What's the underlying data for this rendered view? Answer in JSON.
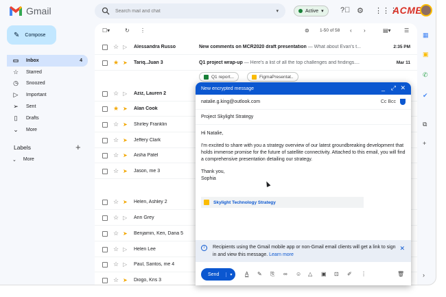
{
  "app": {
    "title": "Gmail",
    "org": "ACME"
  },
  "search": {
    "placeholder": "Search mail and chat"
  },
  "status": {
    "label": "Active"
  },
  "compose_label": "Compose",
  "nav": [
    {
      "label": "Inbox",
      "count": "4",
      "icon": "inbox-icon"
    },
    {
      "label": "Starred",
      "count": "",
      "icon": "star-icon"
    },
    {
      "label": "Snoozed",
      "count": "",
      "icon": "clock-icon"
    },
    {
      "label": "Important",
      "count": "",
      "icon": "important-icon"
    },
    {
      "label": "Sent",
      "count": "",
      "icon": "send-icon"
    },
    {
      "label": "Drafts",
      "count": "",
      "icon": "draft-icon"
    },
    {
      "label": "More",
      "count": "",
      "icon": "chevron-down-icon"
    }
  ],
  "labels": {
    "title": "Labels",
    "more": "More"
  },
  "toolbar": {
    "pagination": "1-50 of 58"
  },
  "emails": [
    {
      "sender": "Alessandra Russo",
      "subject": "New comments on MCR2020 draft presentation",
      "snippet": " — What about Evan's t...",
      "date": "2:35 PM",
      "unread": true,
      "starred": false,
      "important": false
    },
    {
      "sender": "Tariq..Juan 3",
      "subject": "Q1 project wrap-up",
      "snippet": " — Here's a list of all the top challenges and findings....",
      "date": "Mar 11",
      "unread": true,
      "starred": true,
      "important": true
    },
    {
      "sender": "Aziz, Lauren 2",
      "subject": "",
      "snippet": "",
      "date": "",
      "unread": true,
      "starred": false,
      "important": false
    },
    {
      "sender": "Alan Cook",
      "subject": "",
      "snippet": "",
      "date": "",
      "unread": true,
      "starred": true,
      "important": true
    },
    {
      "sender": "Shirley Franklin",
      "subject": "",
      "snippet": "",
      "date": "",
      "unread": false,
      "starred": false,
      "important": true
    },
    {
      "sender": "Jeffery Clark",
      "subject": "",
      "snippet": "",
      "date": "",
      "unread": false,
      "starred": false,
      "important": true
    },
    {
      "sender": "Aisha Patel",
      "subject": "",
      "snippet": "",
      "date": "",
      "unread": false,
      "starred": false,
      "important": true
    },
    {
      "sender": "Jason, me 3",
      "subject": "",
      "snippet": "",
      "date": "",
      "unread": false,
      "starred": false,
      "important": true
    },
    {
      "sender": "Helen, Ashley 2",
      "subject": "",
      "snippet": "",
      "date": "",
      "unread": false,
      "starred": false,
      "important": true
    },
    {
      "sender": "Ann Grey",
      "subject": "",
      "snippet": "",
      "date": "",
      "unread": false,
      "starred": false,
      "important": false
    },
    {
      "sender": "Benjamin, Ken, Dana 5",
      "subject": "",
      "snippet": "",
      "date": "",
      "unread": false,
      "starred": false,
      "important": true
    },
    {
      "sender": "Helen Lee",
      "subject": "",
      "snippet": "",
      "date": "",
      "unread": false,
      "starred": false,
      "important": false
    },
    {
      "sender": "Paul, Santos, me 4",
      "subject": "",
      "snippet": "",
      "date": "",
      "unread": false,
      "starred": false,
      "important": false
    },
    {
      "sender": "Diogo, Kris 3",
      "subject": "",
      "snippet": "",
      "date": "",
      "unread": false,
      "starred": false,
      "important": true
    }
  ],
  "attachments_chips": [
    "Q1 report...",
    "FigmaPresentat.."
  ],
  "compose": {
    "title": "New encrypted message",
    "to": "natalie.g.king@outlook.com",
    "cc_bcc": "Cc  Bcc",
    "subject": "Project Skylight Strategy",
    "greeting": "Hi Natalie,",
    "body": "I'm excited to share with you a strategy overview of our latest groundbreaking development that holds immense promise for the future of satellite connectivity. Attached to this email, you will find a comprehensive presentation detailing our strategy.",
    "signoff1": "Thank you,",
    "signoff2": "Sophia",
    "attachment": "Skylight Technology Strategy",
    "info_text": "Recipients using the Gmail mobile app or non-Gmail email clients will get a link to sign in and view this message.",
    "info_link": "Learn more",
    "send_label": "Send"
  },
  "colors": {
    "accent": "#0b57d0",
    "compose_bg": "#c2e7ff",
    "selected": "#d3e3fd",
    "acme": "#d93025"
  }
}
